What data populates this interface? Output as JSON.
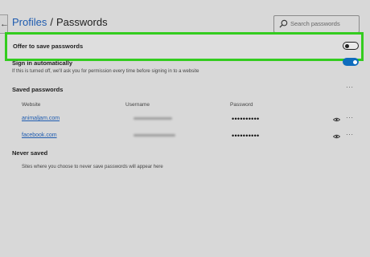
{
  "breadcrumb": {
    "parent": "Profiles",
    "separator": "/",
    "current": "Passwords"
  },
  "search": {
    "placeholder": "Search passwords"
  },
  "offer": {
    "label": "Offer to save passwords",
    "enabled": false
  },
  "sign_in": {
    "label": "Sign in automatically",
    "description": "If this is turned off, we'll ask you for permission every time before signing in to a website",
    "enabled": true
  },
  "saved": {
    "heading": "Saved passwords",
    "columns": {
      "website": "Website",
      "username": "Username",
      "password": "Password"
    },
    "rows": [
      {
        "website": "animaljam.com",
        "password": "••••••••••"
      },
      {
        "website": "facebook.com",
        "password": "••••••••••"
      }
    ]
  },
  "never_saved": {
    "heading": "Never saved",
    "description": "Sites where you choose to never save passwords will appear here"
  },
  "more_glyph": "···",
  "colors": {
    "accent": "#0f6cbd",
    "highlight": "#33cc1f",
    "link": "#1f5cb0"
  }
}
